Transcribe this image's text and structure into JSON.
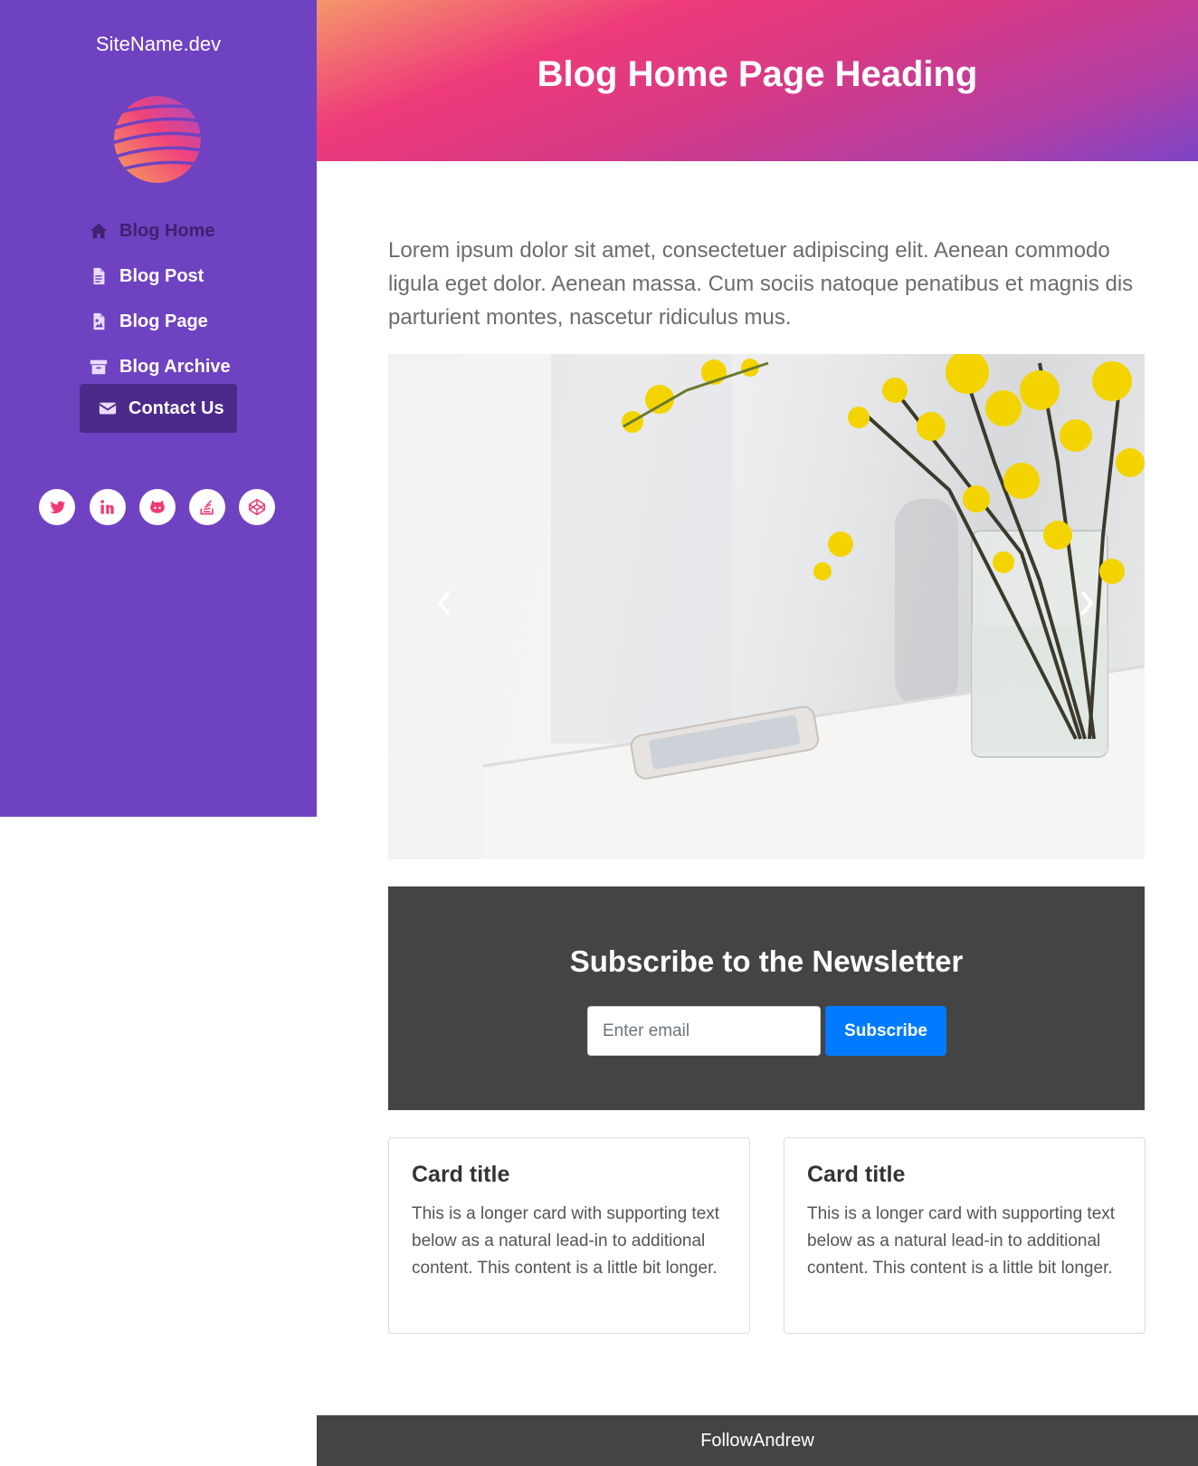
{
  "sidebar": {
    "site_name": "SiteName.dev",
    "logo_colors": [
      "#f7a35c",
      "#f0447a",
      "#a647c9"
    ],
    "nav": [
      {
        "label": "Blog Home",
        "icon": "home-icon",
        "active": true
      },
      {
        "label": "Blog Post",
        "icon": "file-icon",
        "active": false
      },
      {
        "label": "Blog Page",
        "icon": "file-image-icon",
        "active": false
      },
      {
        "label": "Blog Archive",
        "icon": "archive-icon",
        "active": false
      },
      {
        "label": "Contact Us",
        "icon": "envelope-icon",
        "active": false
      }
    ],
    "socials": [
      "twitter-icon",
      "linkedin-icon",
      "github-icon",
      "stackoverflow-icon",
      "codepen-icon"
    ],
    "background": "#6f42c1"
  },
  "header": {
    "heading": "Blog Home Page Heading"
  },
  "main": {
    "intro": "Lorem ipsum dolor sit amet, consectetuer adipiscing elit. Aenean commodo ligula eget dolor. Aenean massa. Cum sociis natoque penatibus et magnis dis parturient montes, nascetur ridiculus mus.",
    "carousel": {
      "prev_icon": "chevron-left-icon",
      "next_icon": "chevron-right-icon"
    }
  },
  "newsletter": {
    "heading": "Subscribe to the Newsletter",
    "email_placeholder": "Enter email",
    "email_value": "",
    "button_label": "Subscribe",
    "button_color": "#007bff"
  },
  "cards": [
    {
      "title": "Card title",
      "text": "This is a longer card with supporting text below as a natural lead-in to additional content. This content is a little bit longer."
    },
    {
      "title": "Card title",
      "text": "This is a longer card with supporting text below as a natural lead-in to additional content. This content is a little bit longer."
    }
  ],
  "footer": {
    "text": "FollowAndrew"
  }
}
